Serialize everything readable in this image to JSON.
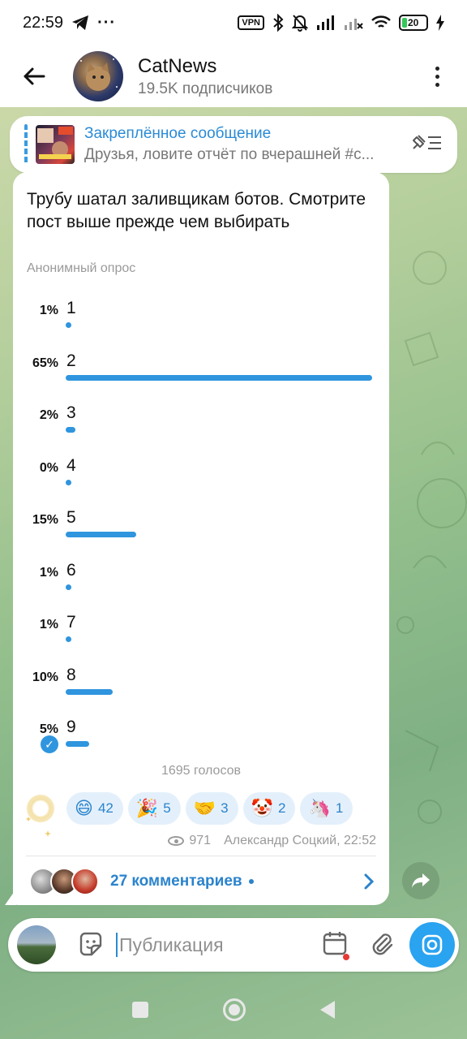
{
  "status_bar": {
    "time": "22:59",
    "vpn": "VPN",
    "battery": "20"
  },
  "header": {
    "title": "CatNews",
    "subtitle": "19.5K подписчиков"
  },
  "pinned": {
    "title": "Закреплённое сообщение",
    "preview": "Друзья, ловите отчёт по вчерашней #с..."
  },
  "poll": {
    "question": "Трубу шатал заливщикам ботов. Смотрите пост выше прежде чем выбирать",
    "type": "Анонимный опрос",
    "options": [
      {
        "label": "1",
        "percent_text": "1%",
        "percent": 1,
        "selected": false
      },
      {
        "label": "2",
        "percent_text": "65%",
        "percent": 65,
        "selected": false
      },
      {
        "label": "3",
        "percent_text": "2%",
        "percent": 2,
        "selected": false
      },
      {
        "label": "4",
        "percent_text": "0%",
        "percent": 0,
        "selected": false
      },
      {
        "label": "5",
        "percent_text": "15%",
        "percent": 15,
        "selected": false
      },
      {
        "label": "6",
        "percent_text": "1%",
        "percent": 1,
        "selected": false
      },
      {
        "label": "7",
        "percent_text": "1%",
        "percent": 1,
        "selected": false
      },
      {
        "label": "8",
        "percent_text": "10%",
        "percent": 10,
        "selected": false
      },
      {
        "label": "9",
        "percent_text": "5%",
        "percent": 5,
        "selected": true
      }
    ],
    "votes": "1695 голосов"
  },
  "reactions": [
    {
      "emoji": "😄",
      "count": "42",
      "icon": "grinning-face-icon"
    },
    {
      "emoji": "🎉",
      "count": "5",
      "icon": "party-popper-icon"
    },
    {
      "emoji": "🤝",
      "count": "3",
      "icon": "handshake-icon"
    },
    {
      "emoji": "🤡",
      "count": "2",
      "icon": "clown-face-icon"
    },
    {
      "emoji": "🦄",
      "count": "1",
      "icon": "unicorn-icon"
    }
  ],
  "message_meta": {
    "views": "971",
    "author_time": "Александр Соцкий, 22:52"
  },
  "comments": {
    "label": "27 комментариев"
  },
  "input": {
    "placeholder": "Публикация"
  },
  "colors": {
    "accent": "#2f95de",
    "link": "#2a83cc",
    "camera_button": "#2aa3f0"
  }
}
